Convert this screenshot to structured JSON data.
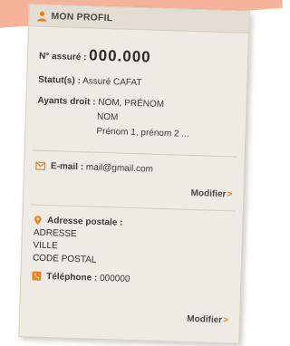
{
  "header": {
    "title": "MON PROFIL",
    "icon": "user-icon"
  },
  "assure": {
    "label": "N° assuré :",
    "number": "000.000"
  },
  "statut": {
    "label": "Statut(s) :",
    "value": "Assuré CAFAT"
  },
  "ayants_droit": {
    "label": "Ayants droit :",
    "lines": [
      "NOM, PRÉNOM",
      "NOM",
      "Prénom 1, prénom 2 ..."
    ]
  },
  "email": {
    "icon": "envelope-icon",
    "label": "E-mail :",
    "value": "mail@gmail.com",
    "modify": "Modifier"
  },
  "postal": {
    "icon": "location-pin-icon",
    "label": "Adresse postale :",
    "lines": [
      "ADRESSE",
      "VILLE",
      "CODE POSTAL"
    ]
  },
  "phone": {
    "icon": "phone-icon",
    "label": "Téléphone :",
    "value": "000000",
    "modify": "Modifier"
  },
  "colors": {
    "accent": "#e8841e",
    "card_bg": "#eeebe5",
    "header_bg": "#e3ddd3",
    "text": "#3d3a37"
  }
}
